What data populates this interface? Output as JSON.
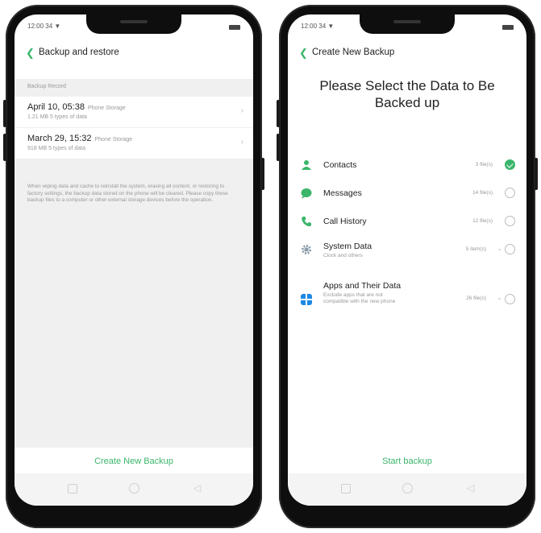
{
  "left": {
    "status_time": "12:00 34 ▼",
    "title": "Backup and restore",
    "section_label": "Backup Record",
    "records": [
      {
        "date": "April 10, 05:38",
        "storage": "Phone Storage",
        "detail": "1.21 MB  5  types of data"
      },
      {
        "date": "March 29, 15:32",
        "storage": "Phone Storage",
        "detail": "918 MB  5  types of data"
      }
    ],
    "note": "When wiping data and cache to reinstall the system, erasing all content, or restoring to factory settings, the backup data stored on the phone will be cleared. Please copy these backup files to a computer or other external storage devices before the operation.",
    "action": "Create New Backup"
  },
  "right": {
    "status_time": "12:00 34 ▼",
    "title": "Create New Backup",
    "heading": "Please Select the Data to Be Backed up",
    "items": [
      {
        "label": "Contacts",
        "sub": "",
        "count": "3 file(s)",
        "checked": true,
        "icon": "contacts-icon",
        "color": "#3bb56b"
      },
      {
        "label": "Messages",
        "sub": "",
        "count": "14 file(s)",
        "checked": false,
        "icon": "messages-icon",
        "color": "#3bb56b"
      },
      {
        "label": "Call History",
        "sub": "",
        "count": "12 file(s)",
        "checked": false,
        "icon": "call-history-icon",
        "color": "#3bb56b"
      },
      {
        "label": "System Data",
        "sub": "Clock and others",
        "count": "5 item(s)",
        "checked": false,
        "icon": "system-gear-icon",
        "color": "#8a9aa8"
      },
      {
        "label": "Apps and Their Data",
        "sub": "Exclude apps that are not compatible with the new phone",
        "count": "26 file(s)",
        "checked": false,
        "icon": "apps-grid-icon",
        "color": "#1e88e5"
      }
    ],
    "action": "Start backup"
  },
  "colors": {
    "accent": "#3bb56b"
  }
}
